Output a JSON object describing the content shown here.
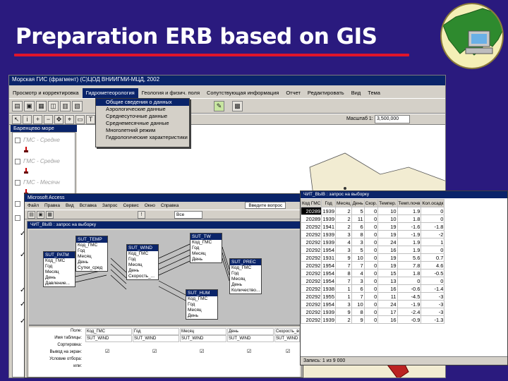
{
  "slide": {
    "title": "Preparation ERB based on GIS"
  },
  "app": {
    "window_title": "Морская ГИС (фрагмент)  (C)ЦОД ВНИИГМИ-МЦД, 2002",
    "menu": [
      "Просмотр и корректировка",
      "Гидрометеорология",
      "Геология и физич. поля",
      "Сопутствующая информация",
      "Отчет",
      "Редактировать",
      "Вид",
      "Тема"
    ],
    "active_menu": 1,
    "scale_label": "Масштаб 1:",
    "scale_value": "3,500,000",
    "map_title": "Баренцево море",
    "dropdown": [
      "Общие сведения о данных",
      "Аэрологические данные",
      "Среднесуточные данные",
      "Среднемесячные данные",
      "Многолетний режим",
      "Гидрологические характеристики"
    ],
    "layers": [
      "ГМС - Средне",
      "ГМС - Средне",
      "ГМС - Месячн"
    ]
  },
  "access": {
    "title": "Microsoft Access",
    "menu": [
      "Файл",
      "Правка",
      "Вид",
      "Вставка",
      "Запрос",
      "Сервис",
      "Окно",
      "Справка"
    ],
    "search_placeholder": "Введите вопрос",
    "all_label": "Все",
    "query_title": "ЧИТ_ВЫВ : запрос на выборку",
    "tables": [
      {
        "name": "SUT_TEMP",
        "fields": [
          "Код_ГМС",
          "Год",
          "Месяц",
          "День",
          "Сутки_сред"
        ]
      },
      {
        "name": "SUT_WIND",
        "fields": [
          "Код_ГМС",
          "Год",
          "Месяц",
          "День",
          "Скорость_..."
        ]
      },
      {
        "name": "SUT_TW",
        "fields": [
          "Код_ГМС",
          "Год",
          "Месяц",
          "День"
        ]
      },
      {
        "name": "SUT_PATM",
        "fields": [
          "Код_ГМС",
          "Год",
          "Месяц",
          "День",
          "Давление..."
        ]
      },
      {
        "name": "SUT_PREC",
        "fields": [
          "Код_ГМС",
          "Год",
          "Месяц",
          "День",
          "Количество..."
        ]
      },
      {
        "name": "SUT_HUM",
        "fields": [
          "Код_ГМС",
          "Год",
          "Месяц",
          "День"
        ]
      }
    ],
    "grid_rows": [
      "Поле:",
      "Имя таблицы:",
      "Сортировка:",
      "Вывод на экран:",
      "Условие отбора:",
      "или:"
    ],
    "grid_cols": [
      {
        "field": "Код_ГМС",
        "table": "SUT_WIND"
      },
      {
        "field": "Год",
        "table": "SUT_WIND"
      },
      {
        "field": "Месяц",
        "table": "SUT_WIND"
      },
      {
        "field": "День",
        "table": "SUT_WIND"
      },
      {
        "field": "Скорость_ве",
        "table": "SUT_WIND"
      }
    ]
  },
  "result": {
    "title": "ЧИТ_ВЫВ : запрос на выборку",
    "headers": [
      "Код ГМС",
      "Год",
      "Месяц",
      "День",
      "Скор.",
      "Темпер.",
      "Темп.почв",
      "Кол.осадк"
    ],
    "rows": [
      [
        "20289",
        "1939",
        "2",
        "5",
        "0",
        "10",
        "1.9",
        "0"
      ],
      [
        "20289",
        "1939",
        "2",
        "11",
        "0",
        "10",
        "1.8",
        "0"
      ],
      [
        "20292",
        "1941",
        "2",
        "6",
        "0",
        "19",
        "-1.6",
        "-1.8"
      ],
      [
        "20292",
        "1939",
        "3",
        "8",
        "0",
        "19",
        "-1.9",
        "-2"
      ],
      [
        "20292",
        "1939",
        "4",
        "3",
        "0",
        "24",
        "1.9",
        "1"
      ],
      [
        "20292",
        "1954",
        "3",
        "5",
        "0",
        "16",
        "1.9",
        "0"
      ],
      [
        "20292",
        "1931",
        "9",
        "10",
        "0",
        "19",
        "5.6",
        "0.7"
      ],
      [
        "20292",
        "1954",
        "7",
        "7",
        "0",
        "19",
        "7.8",
        "4.6"
      ],
      [
        "20292",
        "1954",
        "8",
        "4",
        "0",
        "15",
        "1.8",
        "-0.5"
      ],
      [
        "20292",
        "1954",
        "7",
        "3",
        "0",
        "13",
        "0",
        "0"
      ],
      [
        "20292",
        "1938",
        "1",
        "6",
        "0",
        "16",
        "-0.6",
        "-1.4"
      ],
      [
        "20292",
        "1955",
        "1",
        "7",
        "0",
        "11",
        "-4.5",
        "-3"
      ],
      [
        "20292",
        "1954",
        "3",
        "10",
        "0",
        "24",
        "-1.9",
        "-3"
      ],
      [
        "20292",
        "1939",
        "9",
        "8",
        "0",
        "17",
        "-2.4",
        "-3"
      ],
      [
        "20292",
        "1939",
        "2",
        "9",
        "0",
        "16",
        "-0.9",
        "-1.3"
      ]
    ],
    "record_label": "Запись: 1 из 9 000"
  }
}
